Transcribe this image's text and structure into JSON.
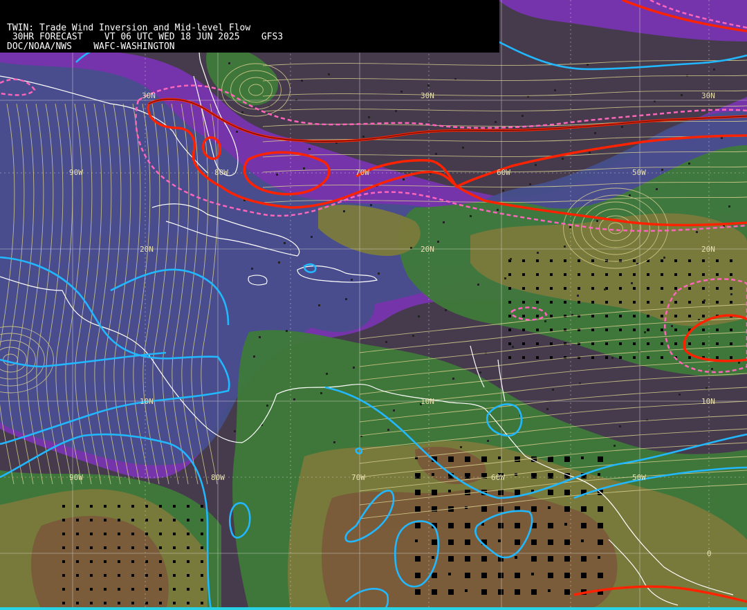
{
  "header": {
    "line1": "TWIN: Trade Wind Inversion and Mid-level Flow",
    "line2": " 30HR FORECAST    VT 06 UTC WED 18 JUN 2025    GFS3",
    "line3": "DOC/NOAA/NWS    WAFC-WASHINGTON"
  },
  "grid_labels": {
    "lat_30n_a": "30N",
    "lat_30n_b": "30N",
    "lat_20n_a": "20N",
    "lat_20n_b": "20N",
    "lat_20n_c": "20N",
    "lat_10n_a": "10N",
    "lat_10n_b": "10N",
    "lat_10n_c": "10N",
    "lon_90w_a": "90W",
    "lon_80w_a": "80W",
    "lon_70w_a": "70W",
    "lon_60w_a": "60W",
    "lon_50w_a": "50W",
    "lon_90w_b": "90W",
    "lon_80w_b": "80W",
    "lon_70w_b": "70W",
    "lon_60w_b": "60W",
    "lon_50w_b": "50W",
    "lon_30n_c": "30N",
    "equator": "0"
  },
  "colors": {
    "background": "#453b4c",
    "purple": "#7b34b6",
    "blue": "#474f8c",
    "green": "#3f7a3a",
    "olive": "#7b7a3c",
    "brown": "#7a5a3a",
    "streamline": "#d9cf8f",
    "cyan_contour": "#21b8ff",
    "red_contour": "#ff2200",
    "pink_dashed": "#ff66bb",
    "coast": "#ffffff"
  }
}
